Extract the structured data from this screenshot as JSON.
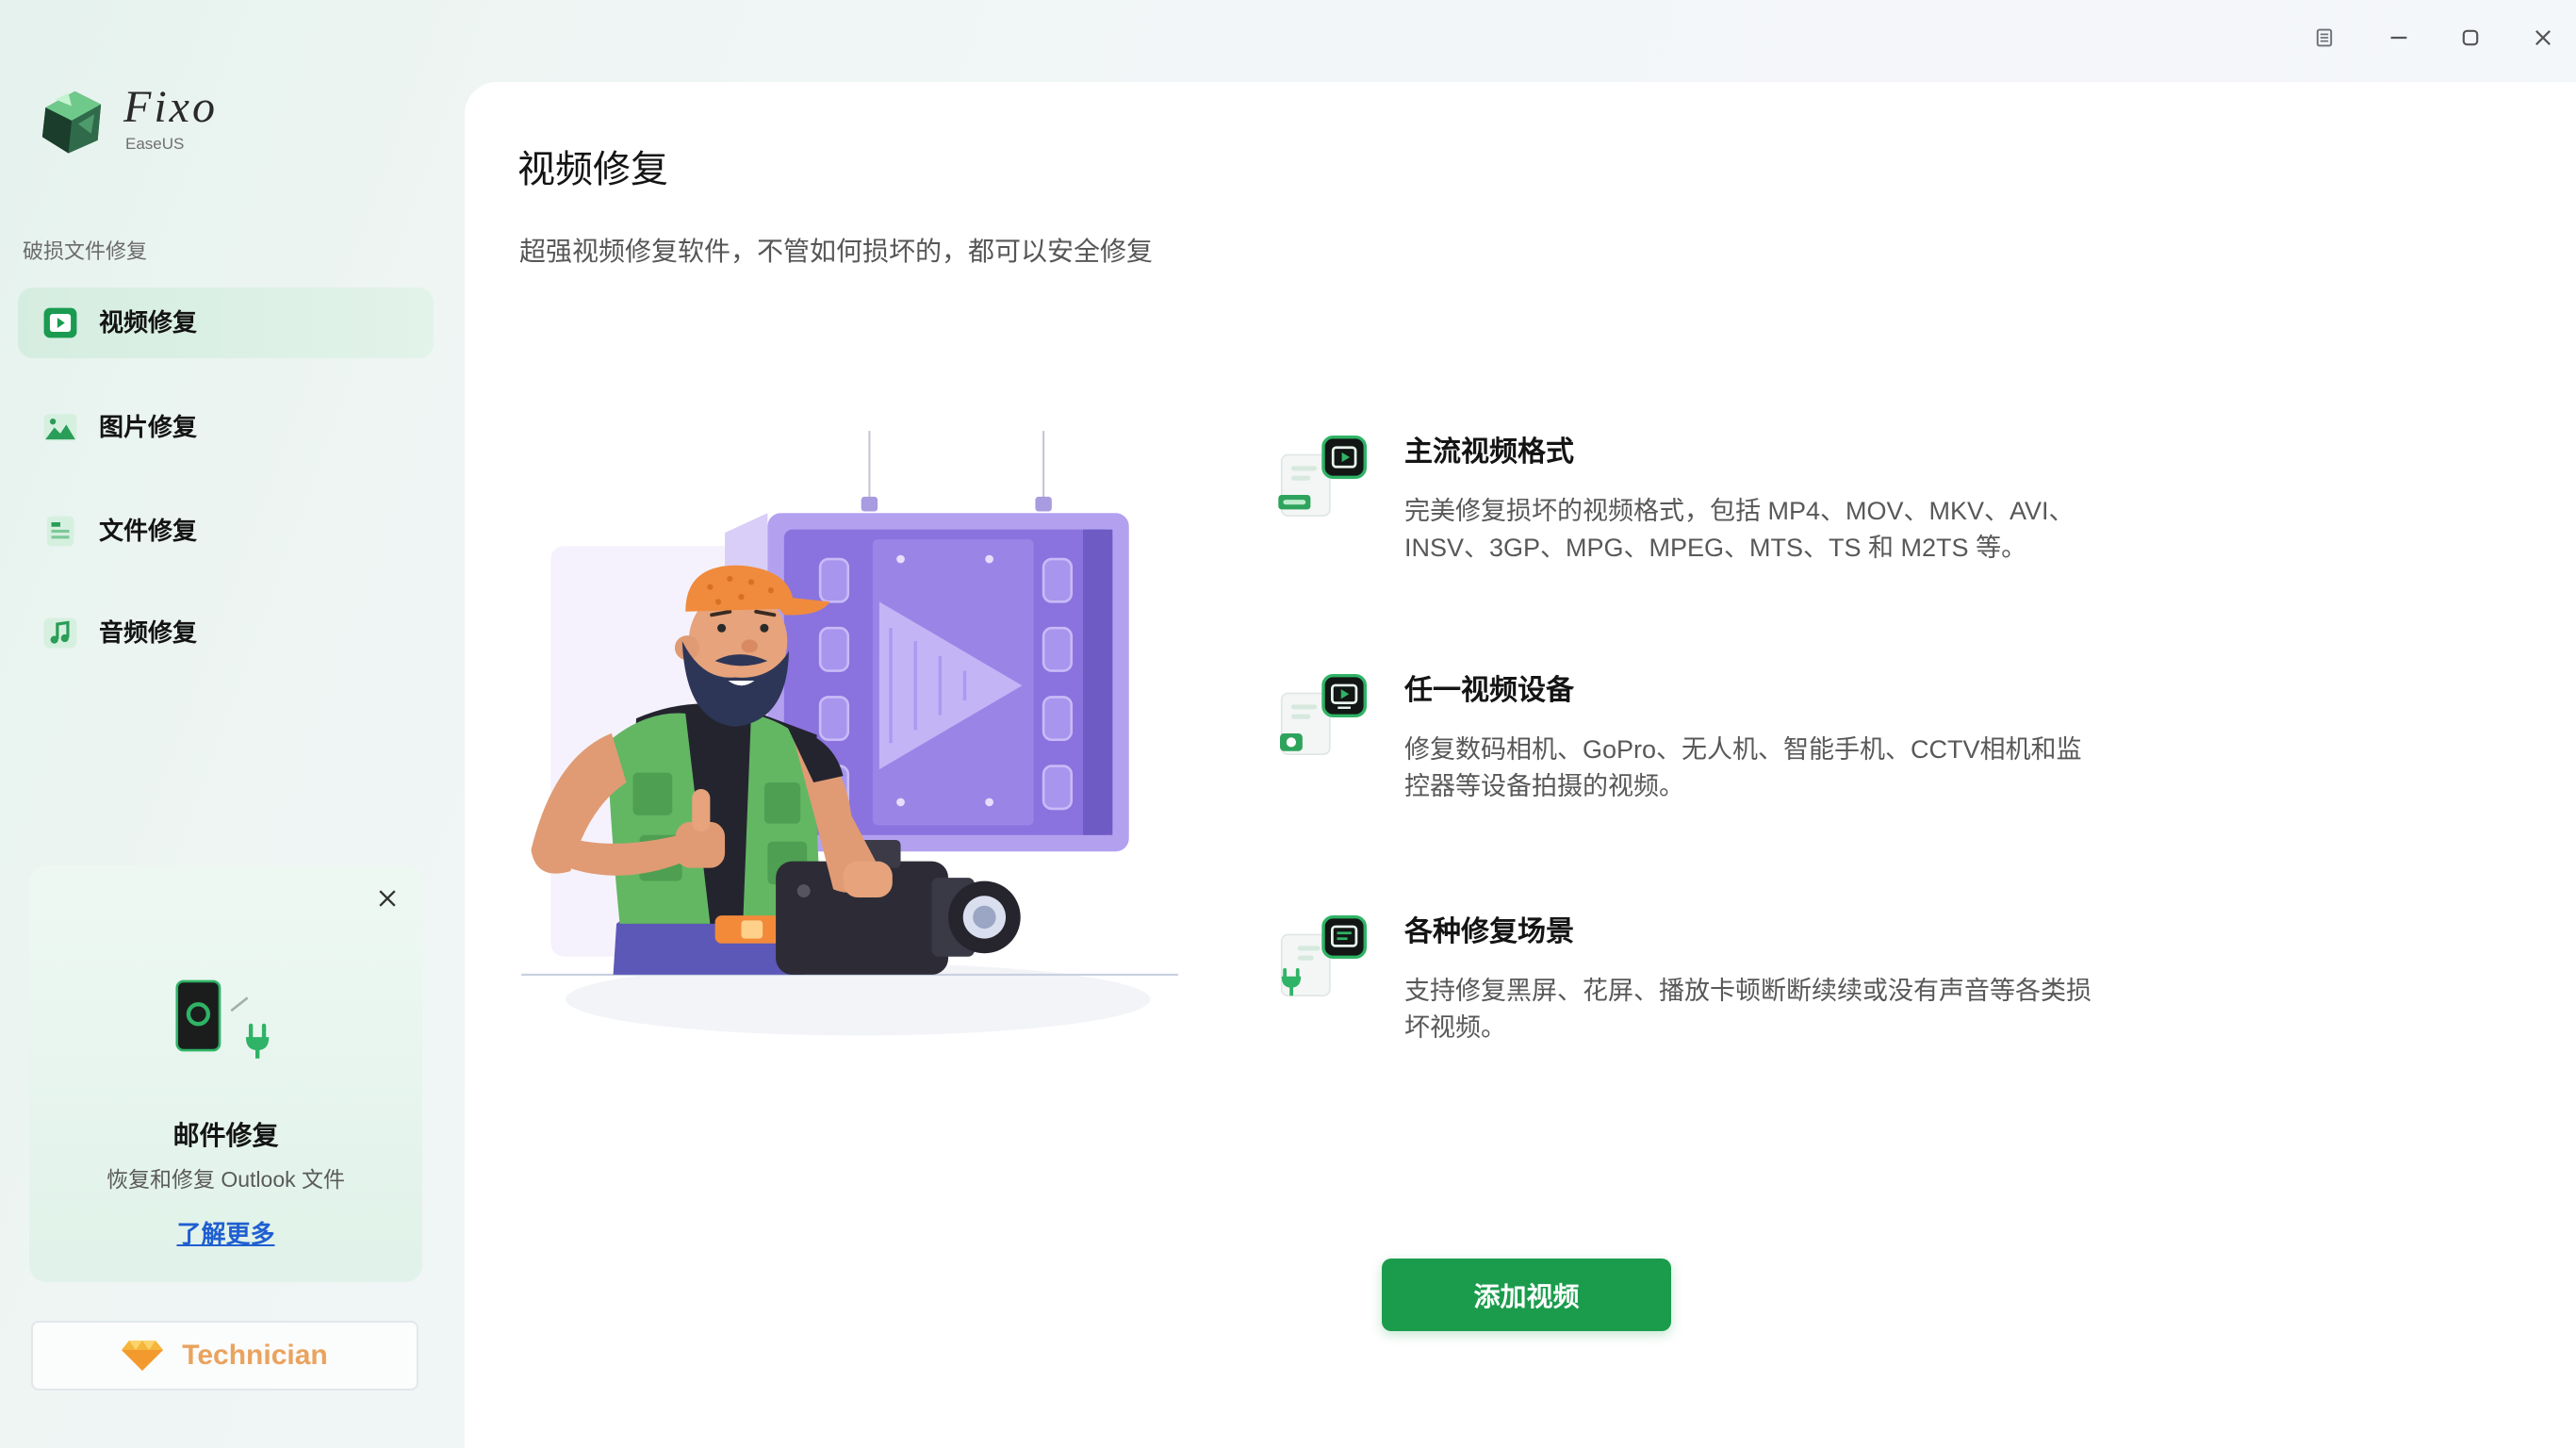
{
  "window": {
    "controls": [
      {
        "icon": "menu-icon"
      },
      {
        "icon": "minimize-icon"
      },
      {
        "icon": "maximize-icon"
      },
      {
        "icon": "close-icon"
      }
    ]
  },
  "brand": {
    "name": "Fixo",
    "company": "EaseUS",
    "icon": "fixo-logo-icon"
  },
  "sidebar": {
    "section_label": "破损文件修复",
    "items": [
      {
        "label": "视频修复",
        "icon": "video-icon",
        "active": true
      },
      {
        "label": "图片修复",
        "icon": "image-icon",
        "active": false
      },
      {
        "label": "文件修复",
        "icon": "file-icon",
        "active": false
      },
      {
        "label": "音频修复",
        "icon": "audio-icon",
        "active": false
      }
    ],
    "promo": {
      "title": "邮件修复",
      "description": "恢复和修复 Outlook 文件",
      "link": "了解更多",
      "icon": "email-repair-icon",
      "close_icon": "close-icon"
    },
    "plan": {
      "label": "Technician",
      "icon": "diamond-icon"
    }
  },
  "main": {
    "title": "视频修复",
    "subtitle": "超强视频修复软件，不管如何损坏的，都可以安全修复",
    "features": [
      {
        "icon": "video-format-icon",
        "title": "主流视频格式",
        "description": "完美修复损坏的视频格式，包括 MP4、MOV、MKV、AVI、INSV、3GP、MPG、MPEG、MTS、TS 和 M2TS 等。"
      },
      {
        "icon": "video-device-icon",
        "title": "任一视频设备",
        "description": "修复数码相机、GoPro、无人机、智能手机、CCTV相机和监控器等设备拍摄的视频。"
      },
      {
        "icon": "repair-scenario-icon",
        "title": "各种修复场景",
        "description": "支持修复黑屏、花屏、播放卡顿断断续续或没有声音等各类损坏视频。"
      }
    ],
    "primary_button": "添加视频"
  },
  "colors": {
    "accent": "#1b9c4c",
    "active_item_bg": "#d5ede0",
    "link": "#1f5fd0",
    "plan_text": "#eaa35e",
    "illustration_purple": "#8a73de"
  }
}
